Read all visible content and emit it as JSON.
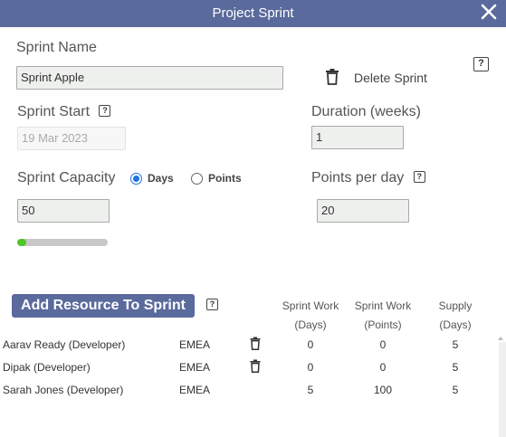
{
  "dialog": {
    "title": "Project Sprint"
  },
  "form": {
    "sprint_name_label": "Sprint Name",
    "sprint_name_value": "Sprint Apple",
    "delete_label": "Delete Sprint",
    "sprint_start_label": "Sprint Start",
    "sprint_start_value": "19 Mar 2023",
    "duration_label": "Duration (weeks)",
    "duration_value": "1",
    "capacity_label": "Sprint Capacity",
    "capacity_options": [
      {
        "label": "Days",
        "selected": true
      },
      {
        "label": "Points",
        "selected": false
      }
    ],
    "capacity_value": "50",
    "points_per_day_label": "Points per day",
    "points_per_day_value": "20",
    "capacity_progress_percent": 10
  },
  "resources": {
    "add_button_label": "Add Resource To Sprint",
    "columns": {
      "work_days": [
        "Sprint Work",
        "(Days)"
      ],
      "work_points": [
        "Sprint Work",
        "(Points)"
      ],
      "supply": [
        "Supply",
        "(Days)"
      ]
    },
    "rows": [
      {
        "name": "Aarav Ready (Developer)",
        "region": "EMEA",
        "deletable": true,
        "work_days": "0",
        "work_points": "0",
        "supply": "5"
      },
      {
        "name": "Dipak (Developer)",
        "region": "EMEA",
        "deletable": true,
        "work_days": "0",
        "work_points": "0",
        "supply": "5"
      },
      {
        "name": "Sarah Jones (Developer)",
        "region": "EMEA",
        "deletable": false,
        "work_days": "5",
        "work_points": "100",
        "supply": "5"
      }
    ]
  },
  "colors": {
    "header": "#5a6a9c",
    "accent": "#1a73e8",
    "progress": "#4ec628"
  },
  "icons": [
    "close-icon",
    "trash-icon",
    "help-icon"
  ]
}
